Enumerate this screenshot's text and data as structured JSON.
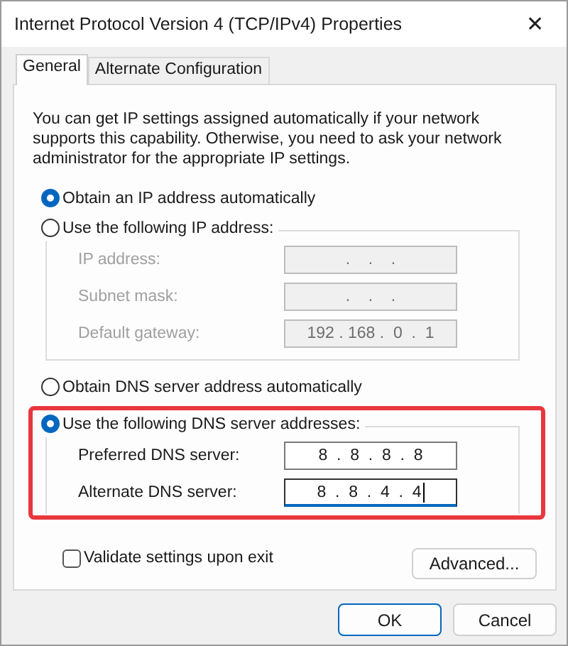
{
  "window": {
    "title": "Internet Protocol Version 4 (TCP/IPv4) Properties",
    "close": "✕"
  },
  "tabs": [
    {
      "label": "General",
      "selected": true
    },
    {
      "label": "Alternate Configuration",
      "selected": false
    }
  ],
  "description": "You can get IP settings assigned automatically if your network supports this capability. Otherwise, you need to ask your network administrator for the appropriate IP settings.",
  "ip_auto": {
    "label": "Obtain an IP address automatically",
    "selected": true
  },
  "ip_manual": {
    "label": "Use the following IP address:",
    "selected": false,
    "fields": [
      {
        "label": "IP address:",
        "value": ".    .    .",
        "disabled": true,
        "focused": false
      },
      {
        "label": "Subnet mask:",
        "value": ".    .    .",
        "disabled": true,
        "focused": false
      },
      {
        "label": "Default gateway:",
        "value": "192 . 168 .  0  .  1",
        "disabled": true,
        "focused": false
      }
    ]
  },
  "dns_auto": {
    "label": "Obtain DNS server address automatically",
    "selected": false
  },
  "dns_manual": {
    "label": "Use the following DNS server addresses:",
    "selected": true,
    "highlighted": true,
    "fields": [
      {
        "label": "Preferred DNS server:",
        "value": "8  .  8  .  8  .  8",
        "disabled": false,
        "focused": false
      },
      {
        "label": "Alternate DNS server:",
        "value": "8  .  8  .  4  .  4",
        "disabled": false,
        "focused": true
      }
    ]
  },
  "validate": {
    "label": "Validate settings upon exit",
    "checked": false
  },
  "advanced_button": "Advanced...",
  "buttons": [
    {
      "label": "OK",
      "default": true
    },
    {
      "label": "Cancel",
      "default": false
    }
  ]
}
